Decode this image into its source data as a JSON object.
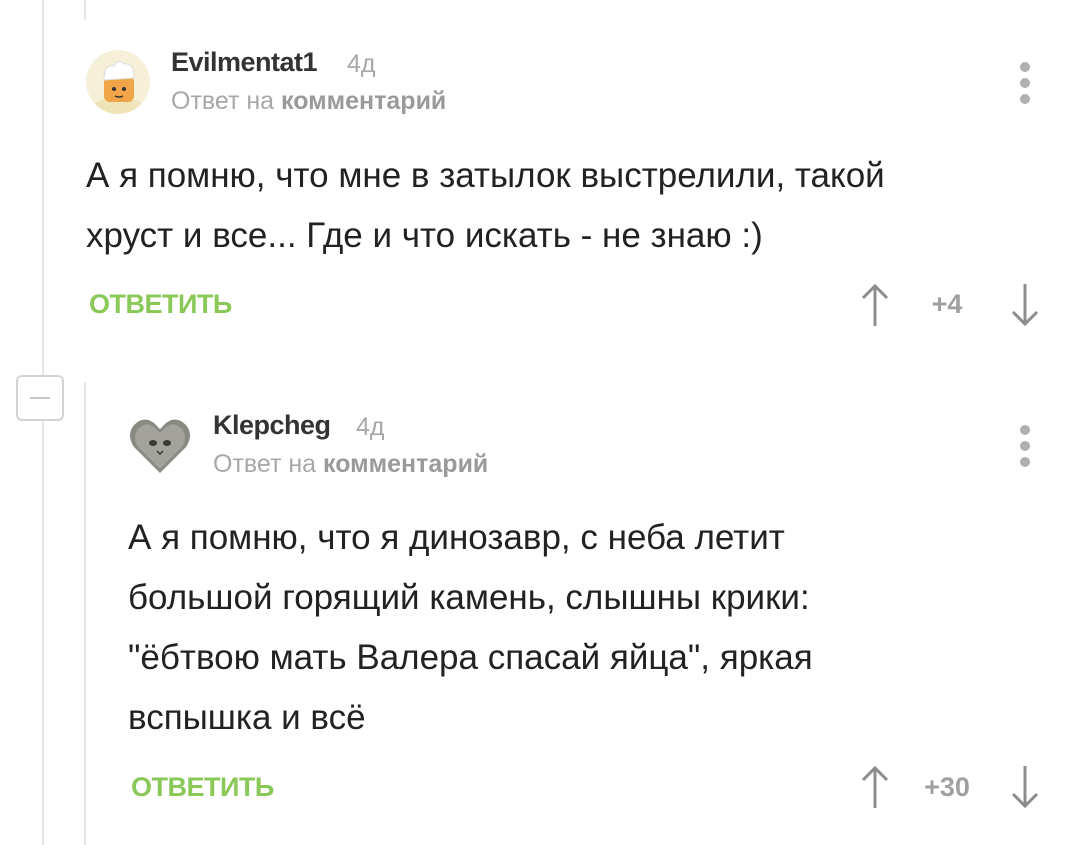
{
  "comments": [
    {
      "author": "Evilmentat1",
      "time": "4д",
      "reply_prefix": "Ответ на",
      "reply_link": "комментарий",
      "text_lines": [
        "А я помню, что мне в затылок выстрелили, такой",
        "хруст и все... Где и что искать - не знаю :)"
      ],
      "reply_label": "ОТВЕТИТЬ",
      "rating": "+4",
      "avatar_icon": "chef-avatar-icon"
    },
    {
      "author": "Klepcheg",
      "time": "4д",
      "reply_prefix": "Ответ на",
      "reply_link": "комментарий",
      "text_lines": [
        "А я помню, что я динозавр, с неба летит",
        "большой горящий камень, слышны крики:",
        "\"ёбтвою мать Валера спасай яйца\", яркая",
        "вспышка и всё"
      ],
      "reply_label": "ОТВЕТИТЬ",
      "rating": "+30",
      "avatar_icon": "cat-heart-avatar-icon"
    }
  ],
  "colors": {
    "accent": "#8ac858",
    "muted": "#a8a8a8",
    "text": "#222222"
  }
}
